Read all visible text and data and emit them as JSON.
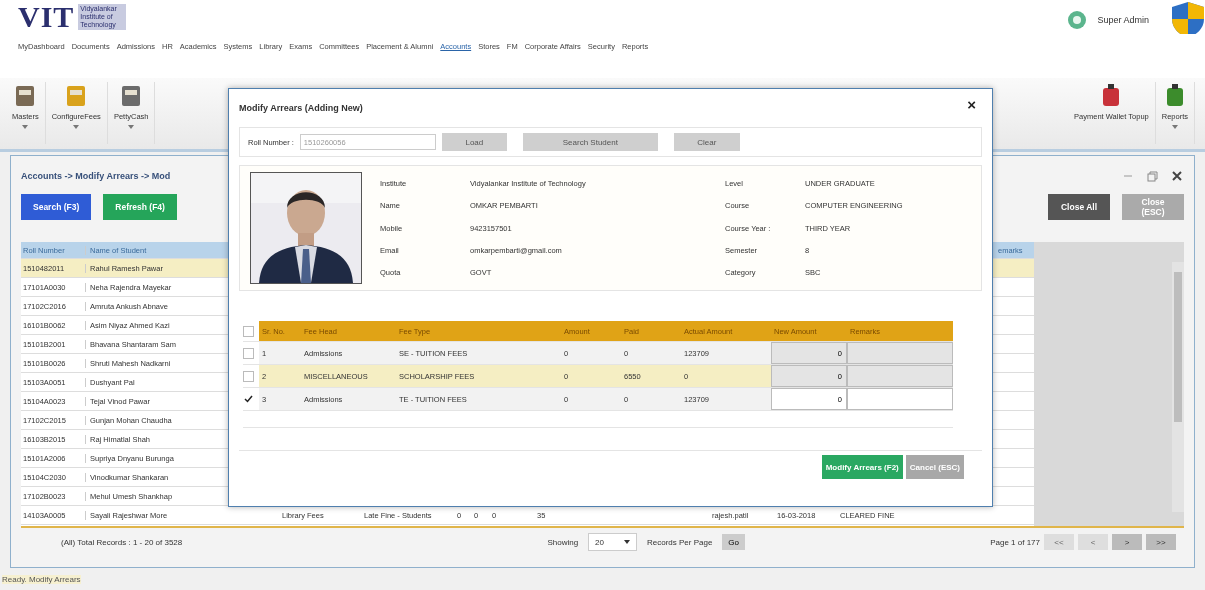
{
  "header": {
    "logo": "VIT",
    "logo_subtitle": "Vidyalankar Institute of Technology",
    "user": "Super Admin"
  },
  "nav": [
    {
      "label": "MyDashboard",
      "selected": false
    },
    {
      "label": "Documents",
      "selected": false
    },
    {
      "label": "Admissions",
      "selected": false
    },
    {
      "label": "HR",
      "selected": false
    },
    {
      "label": "Academics",
      "selected": false
    },
    {
      "label": "Systems",
      "selected": false
    },
    {
      "label": "Library",
      "selected": false
    },
    {
      "label": "Exams",
      "selected": false
    },
    {
      "label": "Committees",
      "selected": false
    },
    {
      "label": "Placement & Alumni",
      "selected": false
    },
    {
      "label": "Accounts",
      "selected": true
    },
    {
      "label": "Stores",
      "selected": false
    },
    {
      "label": "FM",
      "selected": false
    },
    {
      "label": "Corporate Affairs",
      "selected": false
    },
    {
      "label": "Security",
      "selected": false
    },
    {
      "label": "Reports",
      "selected": false
    }
  ],
  "toolbar_left": [
    {
      "label": "Masters",
      "kind": "folder",
      "dropdown": true
    },
    {
      "label": "ConfigureFees",
      "kind": "coins",
      "dropdown": true
    },
    {
      "label": "PettyCash",
      "kind": "box",
      "dropdown": true
    }
  ],
  "toolbar_right": [
    {
      "label": "Payment Wallet Topup",
      "kind": "wallet",
      "dropdown": false
    },
    {
      "label": "Reports",
      "kind": "chart",
      "dropdown": true
    }
  ],
  "panel": {
    "breadcrumb": "Accounts -> Modify Arrears -> Mod",
    "buttons_left": [
      {
        "label": "Search (F3)",
        "kind": "primary"
      },
      {
        "label": "Refresh (F4)",
        "kind": "success"
      }
    ],
    "buttons_right": [
      {
        "label": "Close All",
        "kind": "dark"
      },
      {
        "label": "Close (ESC)",
        "kind": "light"
      }
    ],
    "table": {
      "columns": [
        "Roll Number",
        "Name of Student"
      ],
      "column_fragment": "emarks",
      "rows": [
        {
          "roll": "1510482011",
          "name": "Rahul Ramesh Pawar",
          "selected": true
        },
        {
          "roll": "17101A0030",
          "name": "Neha Rajendra Mayekar",
          "selected": false
        },
        {
          "roll": "17102C2016",
          "name": "Amruta Ankush Abnave",
          "selected": false
        },
        {
          "roll": "16101B0062",
          "name": "Asim Niyaz Ahmed Kazi",
          "selected": false
        },
        {
          "roll": "15101B2001",
          "name": "Bhavana Shantaram Sam",
          "selected": false
        },
        {
          "roll": "15101B0026",
          "name": "Shruti Mahesh Nadkarni",
          "selected": false
        },
        {
          "roll": "15103A0051",
          "name": "Dushyant Pal",
          "selected": false
        },
        {
          "roll": "15104A0023",
          "name": "Tejal Vinod Pawar",
          "selected": false
        },
        {
          "roll": "17102C2015",
          "name": "Gunjan Mohan Chaudha",
          "selected": false
        },
        {
          "roll": "16103B2015",
          "name": "Raj Himatlal Shah",
          "selected": false
        },
        {
          "roll": "15101A2006",
          "name": "Supriya Dnyanu Burunga",
          "selected": false
        },
        {
          "roll": "15104C2030",
          "name": "Vinodkumar Shankaran",
          "selected": false
        },
        {
          "roll": "17102B0023",
          "name": "Mehul Umesh Shankhap",
          "selected": false
        },
        {
          "roll": "14103A0005",
          "name": "Sayali Rajeshwar More",
          "selected": false,
          "extra": [
            "Library Fees",
            "Late Fine - Students",
            "0",
            "0",
            "0",
            "35",
            "rajesh.patil",
            "16-03-2018",
            "CLEARED FINE"
          ]
        }
      ]
    },
    "pager": {
      "total": "(All) Total Records : 1 - 20 of 3528",
      "showing": "Showing",
      "page_size": "20",
      "per_page": "Records Per Page",
      "go": "Go",
      "page": "Page 1 of 177",
      "nav_buttons": [
        {
          "label": "<<",
          "disabled": true
        },
        {
          "label": "<",
          "disabled": true
        },
        {
          "label": ">",
          "disabled": false
        },
        {
          "label": ">>",
          "disabled": false
        }
      ]
    }
  },
  "status_bar": "Ready. Modify Arrears",
  "modal": {
    "title": "Modify Arrears (Adding New)",
    "close": "×",
    "roll_label": "Roll Number :",
    "roll_value": "1510260056",
    "roll_buttons": [
      "Load",
      "Search Student",
      "Clear"
    ],
    "info_left": [
      {
        "label": "Institute",
        "value": "Vidyalankar Institute of Technology"
      },
      {
        "label": "Name",
        "value": "OMKAR PEMBARTI"
      },
      {
        "label": "Mobile",
        "value": "9423157501"
      },
      {
        "label": "Email",
        "value": "omkarpembarti@gmail.com"
      },
      {
        "label": "Quota",
        "value": "GOVT"
      }
    ],
    "info_right": [
      {
        "label": "Level",
        "value": "UNDER GRADUATE"
      },
      {
        "label": "Course",
        "value": "COMPUTER ENGINEERING"
      },
      {
        "label": "Course Year :",
        "value": "THIRD YEAR"
      },
      {
        "label": "Semester",
        "value": "8"
      },
      {
        "label": "Category",
        "value": "SBC"
      }
    ],
    "fee_table": {
      "select_all_checked": false,
      "columns": [
        "Sr. No.",
        "Fee Head",
        "Fee Type",
        "Amount",
        "Paid",
        "Actual Amount",
        "New Amount",
        "Remarks"
      ],
      "rows": [
        {
          "sl": "1",
          "fee_head": "Admissions",
          "fee_type": "SE - TUITION FEES",
          "amount": "0",
          "paid": "0",
          "actual_amount": "123709",
          "new_amount": "0",
          "checked": false,
          "selected": false,
          "editable": false
        },
        {
          "sl": "2",
          "fee_head": "MISCELLANEOUS",
          "fee_type": "SCHOLARSHIP FEES",
          "amount": "0",
          "paid": "6550",
          "actual_amount": "0",
          "new_amount": "0",
          "checked": false,
          "selected": true,
          "editable": false
        },
        {
          "sl": "3",
          "fee_head": "Admissions",
          "fee_type": "TE - TUITION FEES",
          "amount": "0",
          "paid": "0",
          "actual_amount": "123709",
          "new_amount": "0",
          "checked": true,
          "selected": false,
          "editable": true
        }
      ]
    },
    "footer_buttons": [
      {
        "label": "Modify Arrears (F2)",
        "kind": "success"
      },
      {
        "label": "Cancel (ESC)",
        "kind": "muted"
      }
    ]
  }
}
